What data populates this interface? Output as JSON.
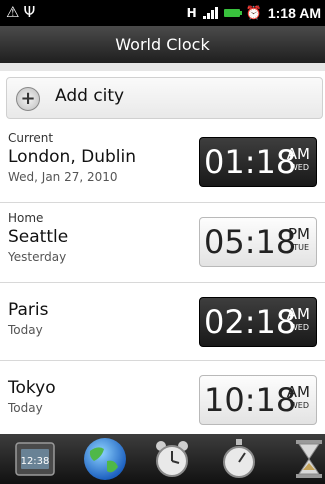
{
  "status_bar": {
    "left_icons": [
      "warning-icon",
      "usb-icon"
    ],
    "network_letter": "H",
    "time": "1:18 AM",
    "battery_color": "#39c23d"
  },
  "title": "World Clock",
  "add_city": {
    "label": "Add city",
    "icon": "plus-icon"
  },
  "clocks": [
    {
      "tag": "Current",
      "city": "London, Dublin",
      "date": "Wed, Jan 27, 2010",
      "time": "01:18",
      "ampm": "AM",
      "day": "WED",
      "style": "dark"
    },
    {
      "tag": "Home",
      "city": "Seattle",
      "date": "Yesterday",
      "time": "05:18",
      "ampm": "PM",
      "day": "TUE",
      "style": "light"
    },
    {
      "tag": "",
      "city": "Paris",
      "date": "Today",
      "time": "02:18",
      "ampm": "AM",
      "day": "WED",
      "style": "dark"
    },
    {
      "tag": "",
      "city": "Tokyo",
      "date": "Today",
      "time": "10:18",
      "ampm": "AM",
      "day": "WED",
      "style": "light"
    }
  ],
  "tabs": [
    {
      "name": "desk-clock",
      "icon": "desk-clock-icon",
      "selected": false
    },
    {
      "name": "world-clock",
      "icon": "globe-icon",
      "selected": true
    },
    {
      "name": "alarms",
      "icon": "alarm-clock-icon",
      "selected": false
    },
    {
      "name": "stopwatch",
      "icon": "stopwatch-icon",
      "selected": false
    },
    {
      "name": "timer",
      "icon": "hourglass-icon",
      "selected": false
    }
  ]
}
